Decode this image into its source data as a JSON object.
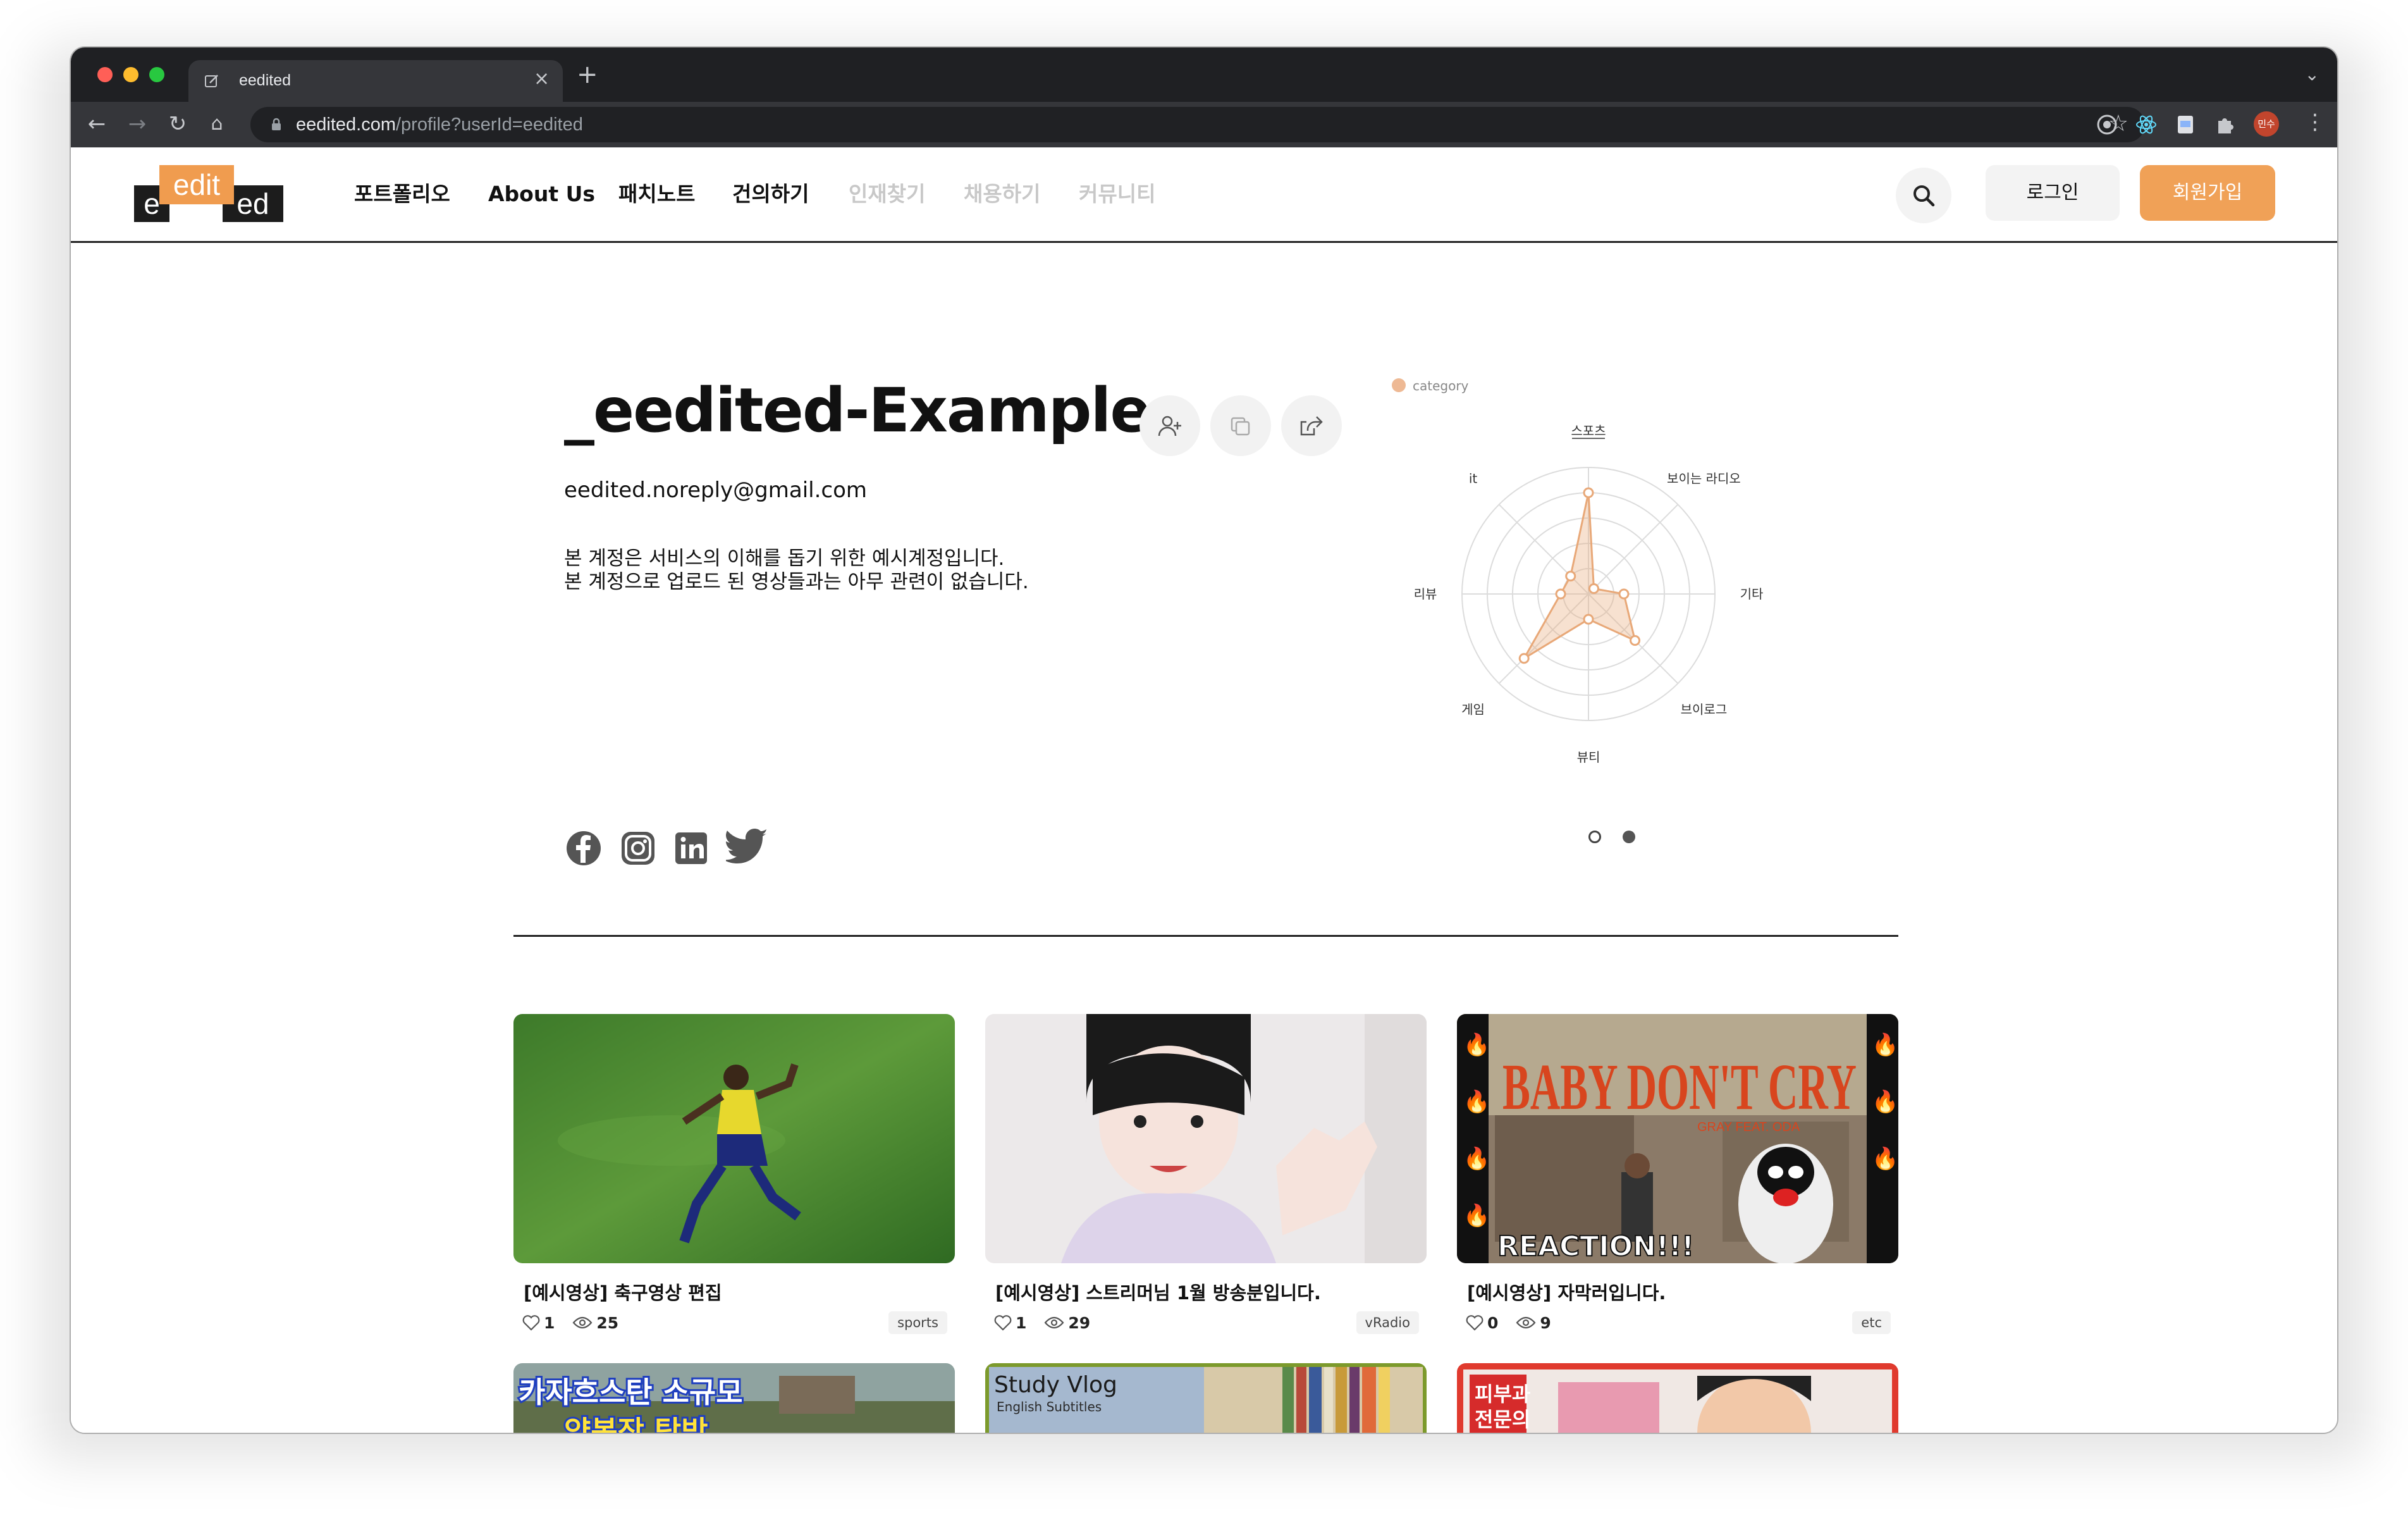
{
  "browser": {
    "tab_title": "eedited",
    "url_host": "eedited.com",
    "url_path": "/profile?userId=eedited",
    "profile_badge": "민수",
    "colors": {
      "red": "#ff5f57",
      "yellow": "#febc2e",
      "green": "#28c840"
    }
  },
  "header": {
    "logo_left": "e",
    "logo_mid": "edit",
    "logo_right": "ed",
    "nav": [
      {
        "label": "포트폴리오",
        "enabled": true
      },
      {
        "label": "About Us",
        "enabled": true
      },
      {
        "label": "패치노트",
        "enabled": true
      },
      {
        "label": "건의하기",
        "enabled": true
      },
      {
        "label": "인재찾기",
        "enabled": false
      },
      {
        "label": "채용하기",
        "enabled": false
      },
      {
        "label": "커뮤니티",
        "enabled": false
      }
    ],
    "login_label": "로그인",
    "signup_label": "회원가입",
    "accent": "#f0a157"
  },
  "profile": {
    "name": "_eedited-Example_",
    "email": "eedited.noreply@gmail.com",
    "bio_line1": "본 계정은 서비스의 이해를 돕기 위한 예시계정입니다.",
    "bio_line2": "본 계정으로 업로드 된 영상들과는 아무 관련이 없습니다.",
    "actions": [
      "follow-icon",
      "copy-icon",
      "share-icon"
    ],
    "social": [
      "facebook-icon",
      "instagram-icon",
      "linkedin-icon",
      "twitter-icon"
    ]
  },
  "chart_data": {
    "type": "radar",
    "legend": "category",
    "categories": [
      "스포츠",
      "보이는 라디오",
      "기타",
      "브이로그",
      "뷰티",
      "게임",
      "리뷰",
      "it"
    ],
    "series": [
      {
        "name": "category",
        "values": [
          4,
          0.3,
          1.4,
          2.6,
          1,
          3.6,
          1.1,
          1
        ]
      }
    ],
    "rmax": 5,
    "color": "#e8a878",
    "carousel_active": 1
  },
  "videos": [
    {
      "title": "[예시영상] 축구영상 편집",
      "likes": "1",
      "views": "25",
      "tag": "sports"
    },
    {
      "title": "[예시영상] 스트리머님 1월 방송분입니다.",
      "likes": "1",
      "views": "29",
      "tag": "vRadio"
    },
    {
      "title": "[예시영상] 자막러입니다.",
      "likes": "0",
      "views": "9",
      "tag": "etc"
    }
  ],
  "thumb_text": {
    "v3_title": "BABY DON'T CRY",
    "v3_sub": "GRAY  FEAT.  ODA",
    "v3_banner": "REACTION!!!",
    "r1": "카자흐스탄 소규모",
    "r1b": "양봉장 탐방",
    "r2": "Study Vlog",
    "r2b": "English Subtitles",
    "r3": "피부과",
    "r3b": "전문의"
  }
}
